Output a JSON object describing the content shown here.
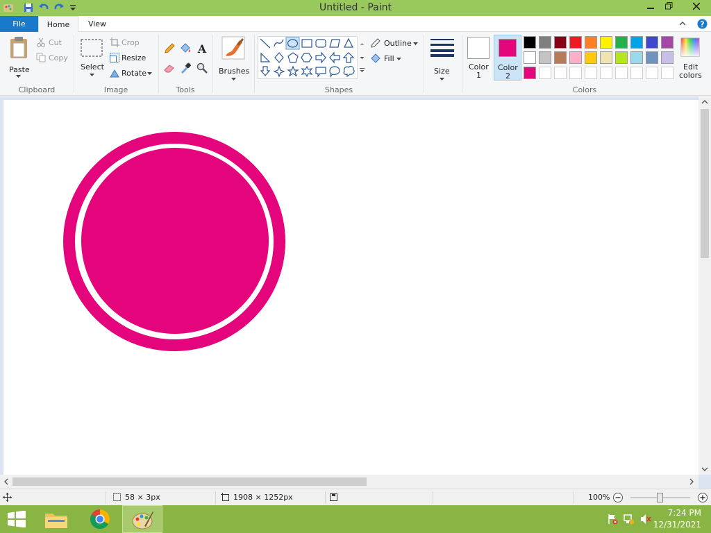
{
  "window": {
    "title": "Untitled - Paint"
  },
  "tabs": {
    "file": "File",
    "home": "Home",
    "view": "View"
  },
  "clipboard": {
    "paste": "Paste",
    "cut": "Cut",
    "copy": "Copy",
    "group": "Clipboard"
  },
  "image": {
    "select": "Select",
    "crop": "Crop",
    "resize": "Resize",
    "rotate": "Rotate",
    "group": "Image"
  },
  "tools": {
    "group": "Tools",
    "text_tool_glyph": "A"
  },
  "brushes": {
    "label": "Brushes"
  },
  "shapes": {
    "outline": "Outline",
    "fill": "Fill",
    "group": "Shapes"
  },
  "size": {
    "label": "Size"
  },
  "colors": {
    "color1_label": "Color",
    "color1_num": "1",
    "color2_label": "Color",
    "color2_num": "2",
    "color1_value": "#ffffff",
    "color2_value": "#e4047b",
    "edit_colors_line1": "Edit",
    "edit_colors_line2": "colors",
    "group": "Colors",
    "palette_row1": [
      "#000000",
      "#7f7f7f",
      "#880015",
      "#ed1c24",
      "#ff7f27",
      "#fff200",
      "#22b14c",
      "#00a2e8",
      "#3f48cc",
      "#a349a4"
    ],
    "palette_row2": [
      "#ffffff",
      "#c3c3c3",
      "#b97a57",
      "#ffaec9",
      "#ffc90e",
      "#efe4b0",
      "#b5e61d",
      "#99d9ea",
      "#7092be",
      "#c8bfe7"
    ],
    "palette_row3": [
      "#e4047b"
    ]
  },
  "canvas": {
    "shape_color": "#e4047b"
  },
  "status": {
    "selection_size": "58 × 3px",
    "image_size": "1908 × 1252px",
    "zoom": "100%"
  },
  "taskbar": {
    "time": "7:24 PM",
    "date": "12/31/2021"
  }
}
